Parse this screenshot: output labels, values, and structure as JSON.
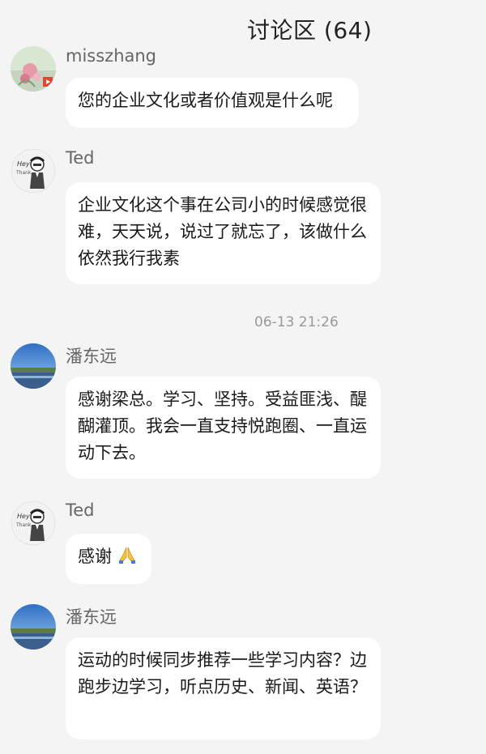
{
  "header": {
    "title": "讨论区 (64)"
  },
  "messages": [
    {
      "user": "misszhang",
      "avatar_icon": "flower-photo-avatar",
      "text": "您的企业文化或者价值观是什么呢"
    },
    {
      "user": "Ted",
      "avatar_icon": "cartoon-man-avatar",
      "text": "企业文化这个事在公司小的时候感觉很难，天天说，说过了就忘了，该做什么依然我行我素"
    },
    {
      "user": "潘东远",
      "avatar_icon": "landscape-photo-avatar",
      "text": "感谢梁总。学习、坚持。受益匪浅、醍醐灌顶。我会一直支持悦跑圈、一直运动下去。"
    },
    {
      "user": "Ted",
      "avatar_icon": "cartoon-man-avatar",
      "text": "感谢",
      "emoji": "praying-hands-icon"
    },
    {
      "user": "潘东远",
      "avatar_icon": "landscape-photo-avatar",
      "text": "运动的时候同步推荐一些学习内容？边跑步边学习，听点历史、新闻、英语？"
    }
  ],
  "timestamp": "06-13 21:26",
  "colors": {
    "background": "#f4f4f4",
    "bubble": "#ffffff",
    "name": "#666666",
    "timestamp": "#999999"
  }
}
